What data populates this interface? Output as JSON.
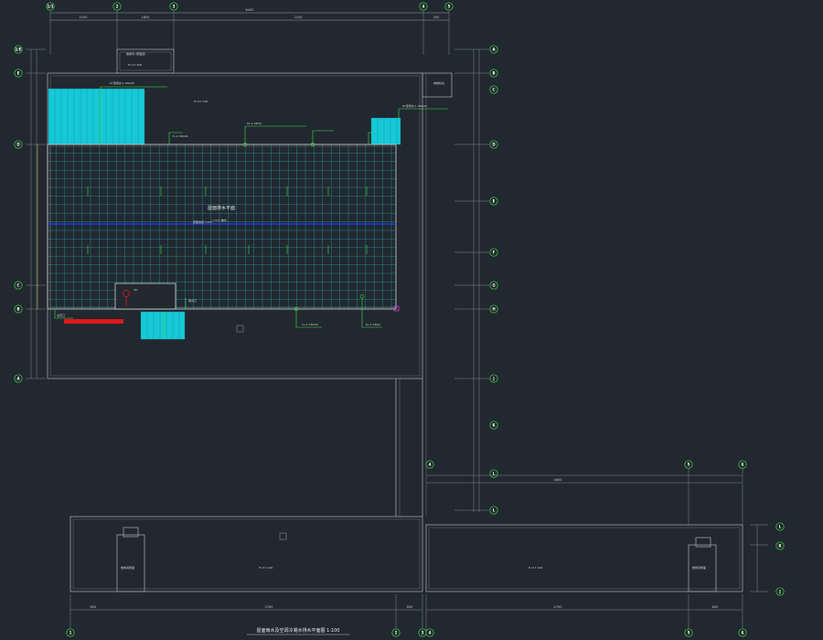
{
  "drawing": {
    "title": "屋面雨水及空调冷凝水排水平面图 1:100",
    "subtitle": "——————————————————————",
    "roof_label": "屋面排水平面",
    "roof_slope": "i=1%  坡向",
    "colors": {
      "background": "#212830",
      "wall": "#9aa0a6",
      "grid_cell": "#2a8f8f",
      "cyan_fill": "#17c8d6",
      "green_pipe": "#3ee03e",
      "blue_line": "#2a3cff",
      "red_pipe": "#e01818",
      "magenta": "#e040e0",
      "axis_circle": "#3ee03e"
    }
  },
  "axes": {
    "top": [
      "1/1",
      "2",
      "3",
      "4",
      "5",
      "1/5"
    ],
    "right_upper": [
      "A",
      "B",
      "C",
      "D",
      "E",
      "F",
      "G",
      "H"
    ],
    "right_lower": [
      "J",
      "K",
      "L"
    ],
    "left": [
      "1/E",
      "E",
      "D",
      "C",
      "B",
      "A",
      "1/A"
    ],
    "bottom": [
      "1",
      "2",
      "3",
      "4",
      "5"
    ],
    "bottom_right_top": [
      "4",
      "5",
      "6"
    ],
    "bottom_right_side": [
      "L",
      "K",
      "J"
    ]
  },
  "dimensions": {
    "top_total": "8400",
    "top_segments": [
      "300",
      "2100",
      "1800",
      "2100",
      "1800",
      "300"
    ],
    "right_segments": [
      "1500",
      "600",
      "1800",
      "2400",
      "1800",
      "600",
      "1500",
      "1200"
    ],
    "bottom_total": "14400",
    "bottom_segments": [
      "600",
      "2700",
      "600",
      "2700",
      "600"
    ],
    "lower_right_total": "4800"
  },
  "annotations": {
    "stair_room": "楼梯间 (屋面层)",
    "stair_room_elev": "H=17.400",
    "rain_hopper": "87型雨水斗 DN100",
    "rain_pipe": "YL-1 DN100",
    "condensate": "KL-1 DN32",
    "overflow": "溢流口",
    "roof_elev": "H=17.100",
    "mech_room": "电梯机房",
    "note_low": "屋面坡度 i=2%",
    "drain_note": "雨水口",
    "lower_left_label": "楼梯间屋面",
    "lower_right_label": "楼梯间屋面",
    "small_box": "W1"
  }
}
